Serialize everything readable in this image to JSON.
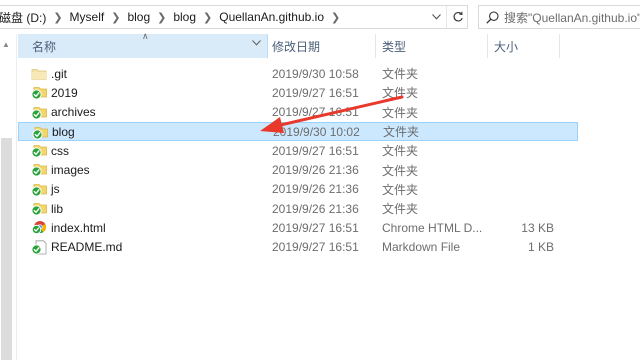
{
  "address_bar": {
    "crumbs": [
      "磁盘 (D:)",
      "Myself",
      "blog",
      "blog",
      "QuellanAn.github.io"
    ]
  },
  "search": {
    "placeholder": "搜索\"QuellanAn.github.io\""
  },
  "columns": {
    "name": "名称",
    "date": "修改日期",
    "type": "类型",
    "size": "大小"
  },
  "files": [
    {
      "name": ".git",
      "date": "2019/9/30 10:58",
      "type": "文件夹",
      "size": "",
      "icon": "folder-plain-icon"
    },
    {
      "name": "2019",
      "date": "2019/9/27 16:51",
      "type": "文件夹",
      "size": "",
      "icon": "folder-synced-icon"
    },
    {
      "name": "archives",
      "date": "2019/9/27 16:51",
      "type": "文件夹",
      "size": "",
      "icon": "folder-synced-icon"
    },
    {
      "name": "blog",
      "date": "2019/9/30 10:02",
      "type": "文件夹",
      "size": "",
      "icon": "folder-synced-icon"
    },
    {
      "name": "css",
      "date": "2019/9/27 16:51",
      "type": "文件夹",
      "size": "",
      "icon": "folder-synced-icon"
    },
    {
      "name": "images",
      "date": "2019/9/26 21:36",
      "type": "文件夹",
      "size": "",
      "icon": "folder-synced-icon"
    },
    {
      "name": "js",
      "date": "2019/9/26 21:36",
      "type": "文件夹",
      "size": "",
      "icon": "folder-synced-icon"
    },
    {
      "name": "lib",
      "date": "2019/9/26 21:36",
      "type": "文件夹",
      "size": "",
      "icon": "folder-synced-icon"
    },
    {
      "name": "index.html",
      "date": "2019/9/27 16:51",
      "type": "Chrome HTML D...",
      "size": "13 KB",
      "icon": "chrome-html-file-icon"
    },
    {
      "name": "README.md",
      "date": "2019/9/27 16:51",
      "type": "Markdown File",
      "size": "1 KB",
      "icon": "markdown-file-synced-icon"
    }
  ],
  "selected_index": 3,
  "colors": {
    "selection_bg": "#cce8ff",
    "selection_border": "#99d1ff",
    "header_active_bg": "#d9ebf9",
    "header_text": "#4c607a",
    "sync_green": "#2aa33a",
    "annotation_red": "#e8392c"
  }
}
